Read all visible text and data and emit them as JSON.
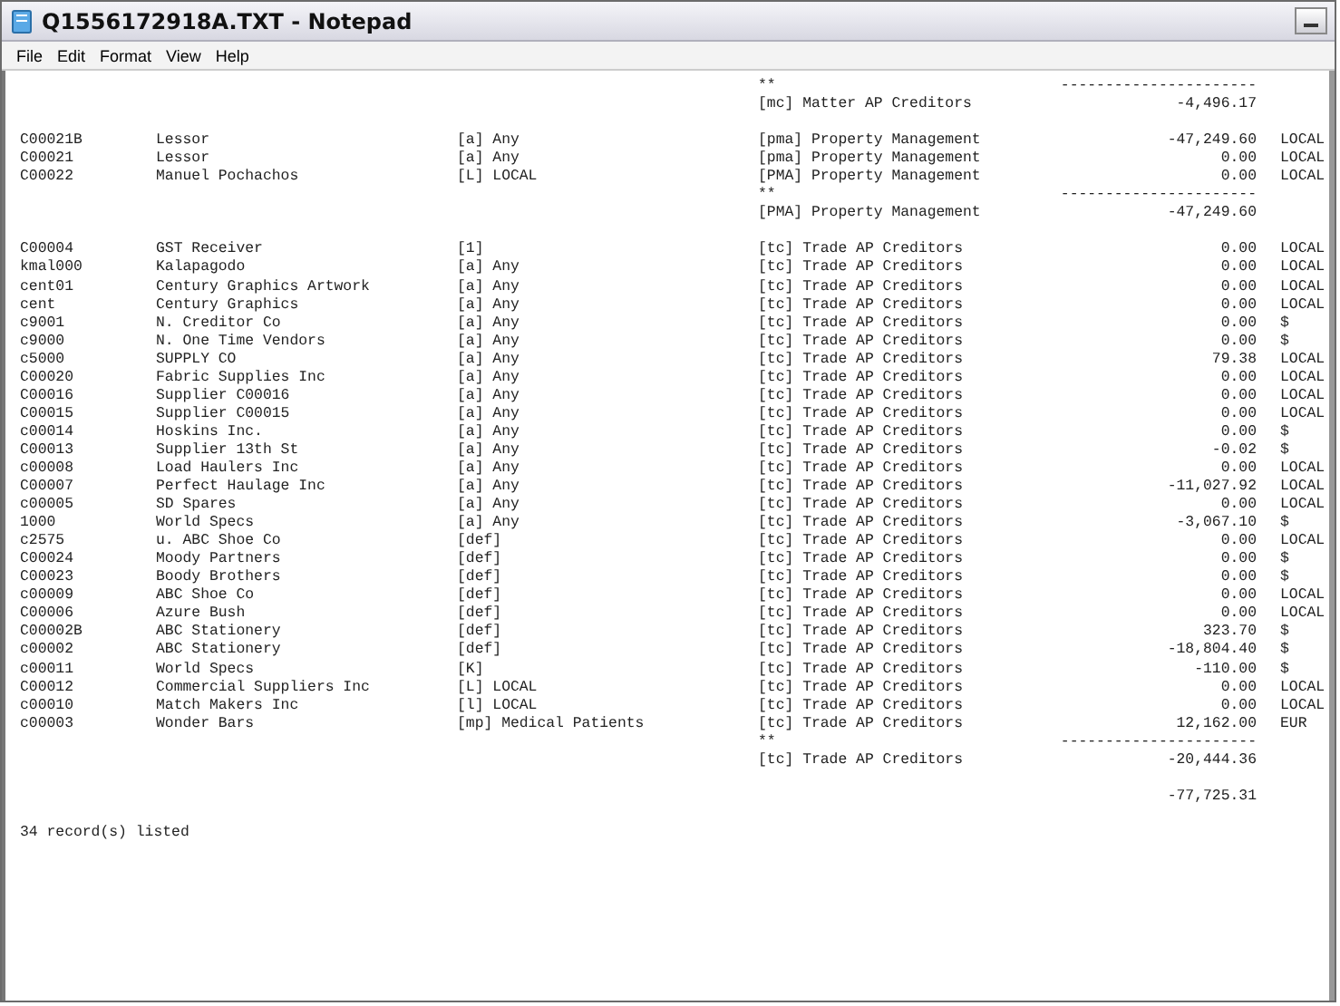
{
  "window": {
    "title": "Q1556172918A.TXT - Notepad"
  },
  "menu": [
    "File",
    "Edit",
    "Format",
    "View",
    "Help"
  ],
  "lines": [
    {
      "kind": "rule",
      "marker": "**",
      "rule": "----------------------"
    },
    {
      "kind": "subtotal",
      "ledger": "[mc] Matter AP Creditors",
      "amount": "-4,496.17"
    },
    {
      "kind": "blank"
    },
    {
      "kind": "entry",
      "code": "C00021B",
      "name": "Lessor",
      "group": "[a] Any",
      "ledger": "[pma] Property Management",
      "amount": "-47,249.60",
      "currency": "LOCAL"
    },
    {
      "kind": "entry",
      "code": "C00021",
      "name": "Lessor",
      "group": "[a] Any",
      "ledger": "[pma] Property Management",
      "amount": "0.00",
      "currency": "LOCAL"
    },
    {
      "kind": "entry",
      "code": "C00022",
      "name": "Manuel Pochachos",
      "group": "[L] LOCAL",
      "ledger": "[PMA] Property Management",
      "amount": "0.00",
      "currency": "LOCAL"
    },
    {
      "kind": "rule",
      "marker": "**",
      "rule": "----------------------"
    },
    {
      "kind": "subtotal",
      "ledger": "[PMA] Property Management",
      "amount": "-47,249.60"
    },
    {
      "kind": "blank"
    },
    {
      "kind": "entry",
      "code": "C00004",
      "name": "GST Receiver",
      "group": "[1]",
      "ledger": "[tc] Trade AP Creditors",
      "amount": "0.00",
      "currency": "LOCAL"
    },
    {
      "kind": "entry",
      "code": "kmal000",
      "name": "Kalapagodo",
      "group": "[a] Any",
      "ledger": "[tc] Trade AP Creditors",
      "amount": "0.00",
      "currency": "LOCAL"
    },
    {
      "kind": "entry",
      "code": "cent01",
      "name": "Century Graphics Artwork",
      "group": "[a] Any",
      "ledger": "[tc] Trade AP Creditors",
      "amount": "0.00",
      "currency": "LOCAL"
    },
    {
      "kind": "entry",
      "code": "cent",
      "name": "Century Graphics",
      "group": "[a] Any",
      "ledger": "[tc] Trade AP Creditors",
      "amount": "0.00",
      "currency": "LOCAL"
    },
    {
      "kind": "entry",
      "code": "c9001",
      "name": "N. Creditor Co",
      "group": "[a] Any",
      "ledger": "[tc] Trade AP Creditors",
      "amount": "0.00",
      "currency": "$"
    },
    {
      "kind": "entry",
      "code": "c9000",
      "name": "N. One Time Vendors",
      "group": "[a] Any",
      "ledger": "[tc] Trade AP Creditors",
      "amount": "0.00",
      "currency": "$"
    },
    {
      "kind": "entry",
      "code": "c5000",
      "name": "SUPPLY CO",
      "group": "[a] Any",
      "ledger": "[tc] Trade AP Creditors",
      "amount": "79.38",
      "currency": "LOCAL"
    },
    {
      "kind": "entry",
      "code": "C00020",
      "name": "Fabric Supplies Inc",
      "group": "[a] Any",
      "ledger": "[tc] Trade AP Creditors",
      "amount": "0.00",
      "currency": "LOCAL"
    },
    {
      "kind": "entry",
      "code": "C00016",
      "name": "Supplier C00016",
      "group": "[a] Any",
      "ledger": "[tc] Trade AP Creditors",
      "amount": "0.00",
      "currency": "LOCAL"
    },
    {
      "kind": "entry",
      "code": "C00015",
      "name": "Supplier C00015",
      "group": "[a] Any",
      "ledger": "[tc] Trade AP Creditors",
      "amount": "0.00",
      "currency": "LOCAL"
    },
    {
      "kind": "entry",
      "code": "c00014",
      "name": "Hoskins Inc.",
      "group": "[a] Any",
      "ledger": "[tc] Trade AP Creditors",
      "amount": "0.00",
      "currency": "$"
    },
    {
      "kind": "entry",
      "code": "C00013",
      "name": "Supplier 13th St",
      "group": "[a] Any",
      "ledger": "[tc] Trade AP Creditors",
      "amount": "-0.02",
      "currency": "$"
    },
    {
      "kind": "entry",
      "code": "c00008",
      "name": "Load Haulers Inc",
      "group": "[a] Any",
      "ledger": "[tc] Trade AP Creditors",
      "amount": "0.00",
      "currency": "LOCAL"
    },
    {
      "kind": "entry",
      "code": "C00007",
      "name": "Perfect Haulage Inc",
      "group": "[a] Any",
      "ledger": "[tc] Trade AP Creditors",
      "amount": "-11,027.92",
      "currency": "LOCAL"
    },
    {
      "kind": "entry",
      "code": "c00005",
      "name": "SD Spares",
      "group": "[a] Any",
      "ledger": "[tc] Trade AP Creditors",
      "amount": "0.00",
      "currency": "LOCAL"
    },
    {
      "kind": "entry",
      "code": "1000",
      "name": "World Specs",
      "group": "[a] Any",
      "ledger": "[tc] Trade AP Creditors",
      "amount": "-3,067.10",
      "currency": "$"
    },
    {
      "kind": "entry",
      "code": "c2575",
      "name": "u. ABC Shoe Co",
      "group": "[def]",
      "ledger": "[tc] Trade AP Creditors",
      "amount": "0.00",
      "currency": "LOCAL"
    },
    {
      "kind": "entry",
      "code": "C00024",
      "name": "Moody Partners",
      "group": "[def]",
      "ledger": "[tc] Trade AP Creditors",
      "amount": "0.00",
      "currency": "$"
    },
    {
      "kind": "entry",
      "code": "C00023",
      "name": "Boody Brothers",
      "group": "[def]",
      "ledger": "[tc] Trade AP Creditors",
      "amount": "0.00",
      "currency": "$"
    },
    {
      "kind": "entry",
      "code": "c00009",
      "name": "ABC Shoe Co",
      "group": "[def]",
      "ledger": "[tc] Trade AP Creditors",
      "amount": "0.00",
      "currency": "LOCAL"
    },
    {
      "kind": "entry",
      "code": "C00006",
      "name": "Azure Bush",
      "group": "[def]",
      "ledger": "[tc] Trade AP Creditors",
      "amount": "0.00",
      "currency": "LOCAL"
    },
    {
      "kind": "entry",
      "code": "C00002B",
      "name": "ABC Stationery",
      "group": "[def]",
      "ledger": "[tc] Trade AP Creditors",
      "amount": "323.70",
      "currency": "$"
    },
    {
      "kind": "entry",
      "code": "c00002",
      "name": "ABC Stationery",
      "group": "[def]",
      "ledger": "[tc] Trade AP Creditors",
      "amount": "-18,804.40",
      "currency": "$"
    },
    {
      "kind": "entry",
      "code": "c00011",
      "name": "World Specs",
      "group": "[K]",
      "ledger": "[tc] Trade AP Creditors",
      "amount": "-110.00",
      "currency": "$"
    },
    {
      "kind": "entry",
      "code": "C00012",
      "name": "Commercial Suppliers Inc",
      "group": "[L] LOCAL",
      "ledger": "[tc] Trade AP Creditors",
      "amount": "0.00",
      "currency": "LOCAL"
    },
    {
      "kind": "entry",
      "code": "c00010",
      "name": "Match Makers Inc",
      "group": "[l] LOCAL",
      "ledger": "[tc] Trade AP Creditors",
      "amount": "0.00",
      "currency": "LOCAL"
    },
    {
      "kind": "entry",
      "code": "c00003",
      "name": "Wonder Bars",
      "group": "[mp] Medical Patients",
      "ledger": "[tc] Trade AP Creditors",
      "amount": "12,162.00",
      "currency": "EUR"
    },
    {
      "kind": "rule",
      "marker": "**",
      "rule": "----------------------"
    },
    {
      "kind": "subtotal",
      "ledger": "[tc] Trade AP Creditors",
      "amount": "-20,444.36"
    },
    {
      "kind": "blank"
    },
    {
      "kind": "total",
      "amount": "-77,725.31"
    },
    {
      "kind": "blank"
    },
    {
      "kind": "note",
      "text": "34 record(s) listed"
    }
  ]
}
